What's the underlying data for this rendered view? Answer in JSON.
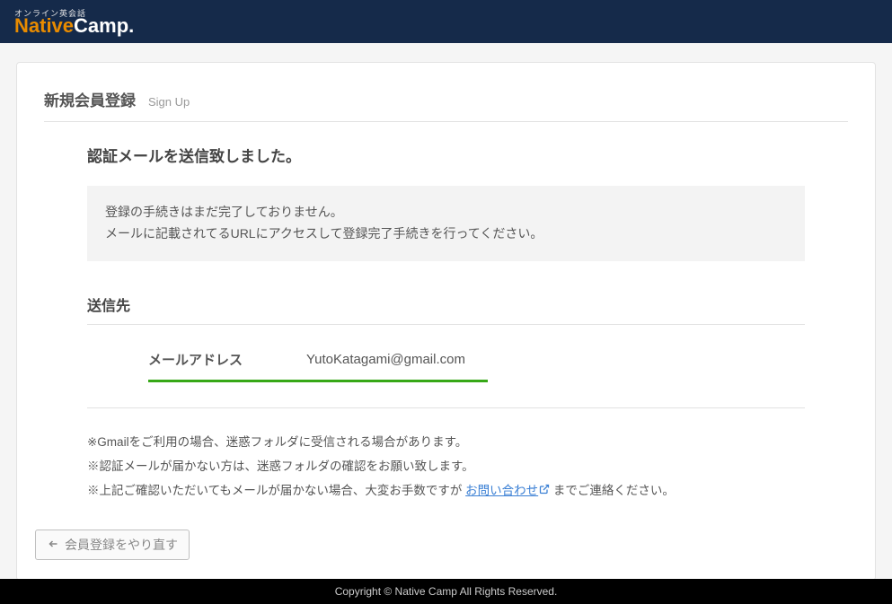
{
  "header": {
    "tagline": "オンライン英会話",
    "logo_native": "Native",
    "logo_camp": "Camp."
  },
  "page": {
    "title_jp": "新規会員登録",
    "title_en": "Sign Up"
  },
  "confirm": {
    "title": "認証メールを送信致しました。",
    "notice_line1": "登録の手続きはまだ完了しておりません。",
    "notice_line2": "メールに記載されてるURLにアクセスして登録完了手続きを行ってください。"
  },
  "sendto": {
    "heading": "送信先",
    "email_label": "メールアドレス",
    "email_value": "YutoKatagami@gmail.com"
  },
  "notes": {
    "n1": "※Gmailをご利用の場合、迷惑フォルダに受信される場合があります。",
    "n2": "※認証メールが届かない方は、迷惑フォルダの確認をお願い致します。",
    "n3_before": "※上記ご確認いただいてもメールが届かない場合、大変お手数ですが ",
    "n3_link": "お問い合わせ",
    "n3_after": " までご連絡ください。"
  },
  "back_button": "会員登録をやり直す",
  "footer": "Copyright © Native Camp All Rights Reserved."
}
